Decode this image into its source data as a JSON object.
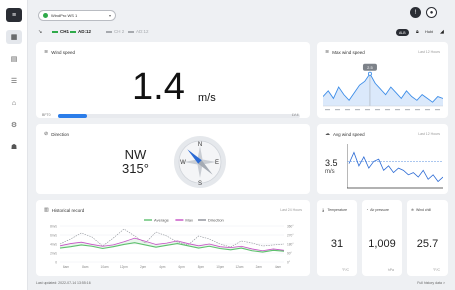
{
  "device": {
    "selected": "WindPro WS 1"
  },
  "header": {
    "badge_label": "ALB",
    "user_label": "Hubi"
  },
  "channels": [
    {
      "label": "CH1",
      "state": "on",
      "color": "#2faa4a"
    },
    {
      "label": "AD:12",
      "state": "on",
      "color": "#2faa4a"
    },
    {
      "label": "CH 2",
      "state": "off",
      "color": "#a6a9ae"
    },
    {
      "label": "AD:12",
      "state": "off",
      "color": "#a6a9ae"
    }
  ],
  "wind_speed": {
    "title": "Wind speed",
    "value": "1.4",
    "unit": "m/s",
    "scale_min": "BFT0",
    "scale_max": "LV.4",
    "level_fraction": 0.12,
    "accent": "#2b7de9"
  },
  "direction": {
    "title": "Direction",
    "cardinal": "NW",
    "degrees": "315°",
    "compass": {
      "n": "N",
      "e": "E",
      "s": "S",
      "w": "W"
    },
    "needle_color": "#2b6ad4"
  },
  "max_wind": {
    "title": "Max wind speed",
    "meta": "Last 12 Hours",
    "tooltip": "2.5",
    "values": [
      1.3,
      1.6,
      1.2,
      1.8,
      1.4,
      1.1,
      1.5,
      1.9,
      2.1,
      2.5,
      2.0,
      1.7,
      1.4,
      1.8,
      1.5,
      1.2,
      1.6,
      1.3,
      1.1,
      1.4,
      1.2,
      1.0,
      1.3,
      1.2
    ],
    "accent": "#3d8de8"
  },
  "avg_wind": {
    "title": "Avg wind speed",
    "meta": "Last 12 Hours",
    "value": "3.5",
    "unit": "m/s",
    "values": [
      3.4,
      3.9,
      3.3,
      3.7,
      3.2,
      3.5,
      3.6,
      3.1,
      3.3,
      3.0,
      3.2,
      3.1,
      2.9,
      3.0,
      2.8,
      3.1,
      2.7,
      2.9,
      2.6,
      2.8
    ],
    "accent": "#2b6ad4"
  },
  "history": {
    "title": "Historical record",
    "meta": "Last 24 Hours",
    "legend": [
      {
        "label": "Average",
        "color": "#5ec06e"
      },
      {
        "label": "Max",
        "color": "#c64fc4"
      },
      {
        "label": "Direction",
        "color": "#8b8f96"
      }
    ],
    "left_ticks": [
      "8m/s",
      "6m/s",
      "4m/s",
      "2m/s",
      "0"
    ],
    "right_ticks": [
      "360°",
      "270°",
      "180°",
      "90°",
      "0°"
    ],
    "x_labels": [
      "6am",
      "8am",
      "10am",
      "12pm",
      "2pm",
      "4pm",
      "6pm",
      "8pm",
      "10pm",
      "12am",
      "2am",
      "4am"
    ],
    "average": [
      3.1,
      3.4,
      3.8,
      3.5,
      3.0,
      3.4,
      3.9,
      4.3,
      3.8,
      3.3,
      3.7,
      4.1,
      3.6,
      3.1,
      3.5,
      3.0,
      2.7,
      3.1,
      2.5,
      2.2,
      2.6,
      2.4
    ],
    "max": [
      3.6,
      4.1,
      4.4,
      3.9,
      3.5,
      3.8,
      4.5,
      5.3,
      4.6,
      3.9,
      4.2,
      4.7,
      4.1,
      3.6,
      4.0,
      3.4,
      3.2,
      3.5,
      2.9,
      2.5,
      2.9,
      2.6
    ],
    "direction": [
      180,
      230,
      290,
      250,
      160,
      240,
      330,
      260,
      190,
      300,
      260,
      200,
      170,
      260,
      230,
      180,
      150,
      210,
      190,
      160,
      170,
      180
    ]
  },
  "temperature": {
    "title": "Temperature",
    "value": "31",
    "unit": "°F/C"
  },
  "air_pressure": {
    "title": "Air pressure",
    "value": "1,009",
    "unit": "hPa"
  },
  "wind_chill": {
    "title": "Wind chill",
    "value": "25.7",
    "unit": "°F/C"
  },
  "footer": {
    "updated": "Last updated: 2022-07-14 13:55:16",
    "right": "Full history data >"
  }
}
